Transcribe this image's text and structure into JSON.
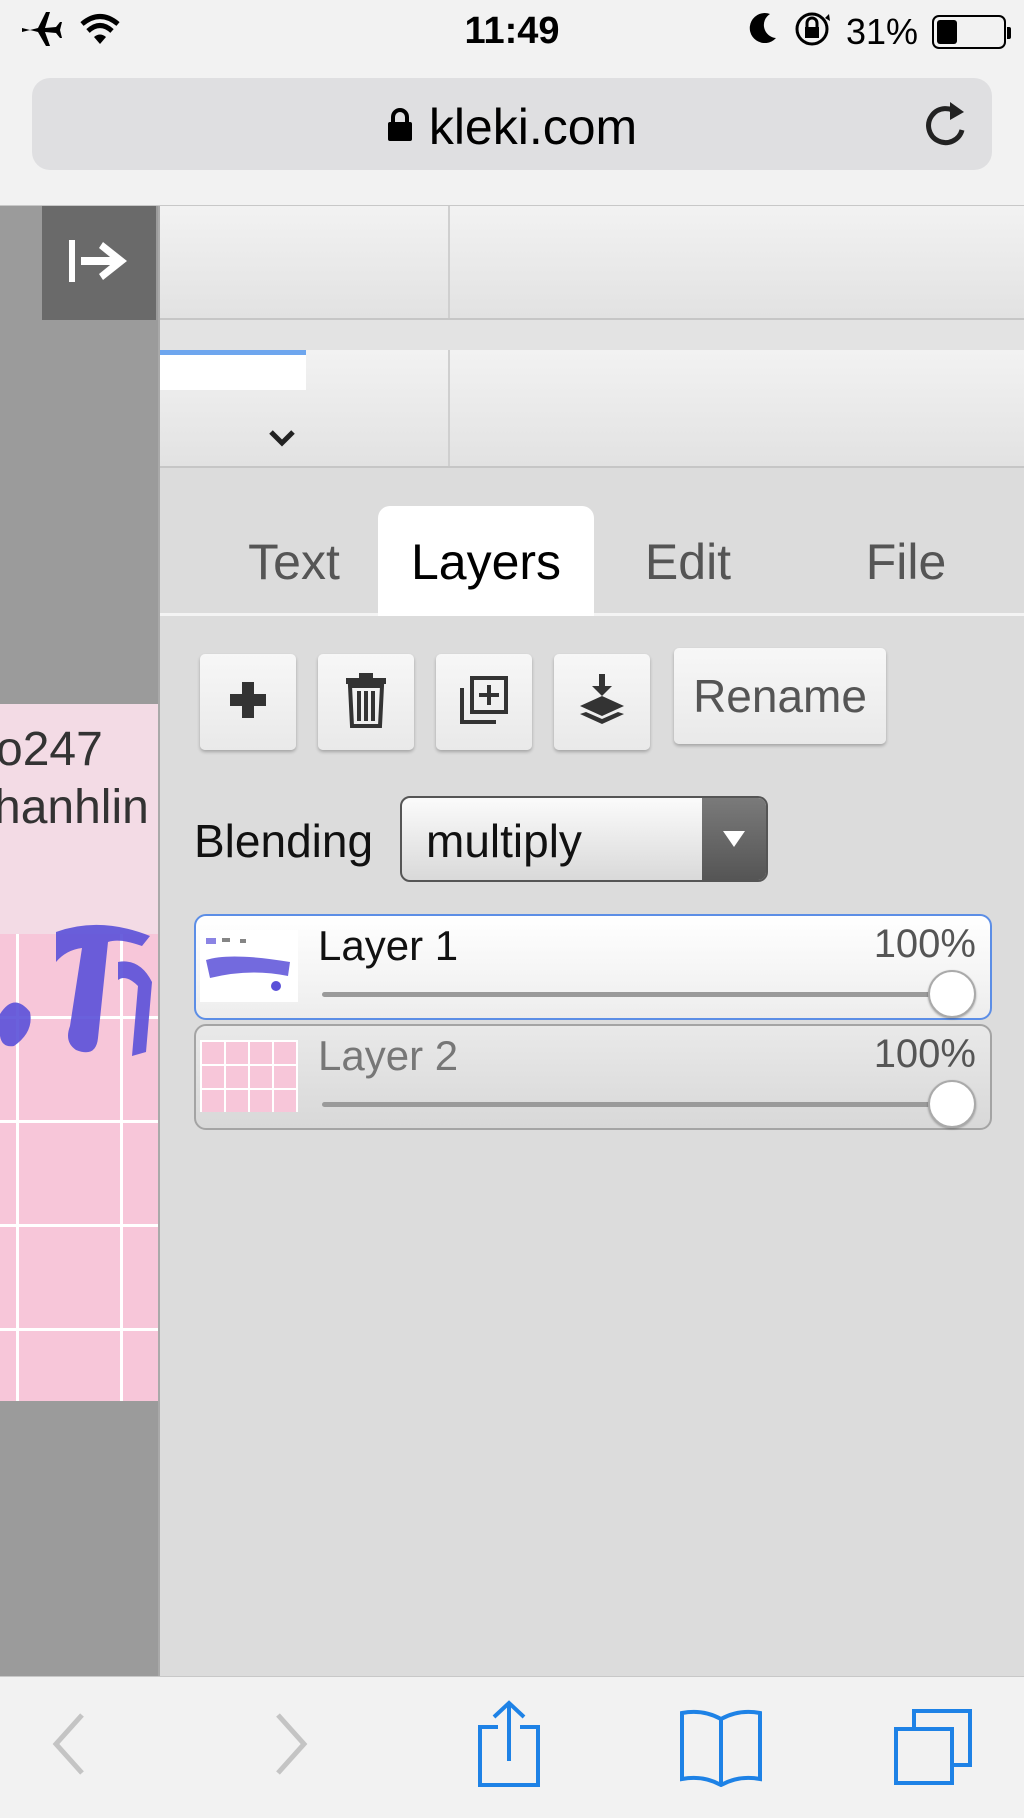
{
  "status_bar": {
    "time": "11:49",
    "battery_text": "31%",
    "battery_level": 0.31,
    "icons": [
      "airplane-icon",
      "wifi-icon",
      "moon-icon",
      "rotation-lock-icon",
      "battery-icon"
    ]
  },
  "browser": {
    "url": "kleki.com",
    "icons": [
      "lock-icon",
      "reload-icon"
    ]
  },
  "canvas": {
    "text_line1": "o247",
    "text_line2": "hanhlin"
  },
  "tabs": [
    {
      "label": "Text",
      "active": false
    },
    {
      "label": "Layers",
      "active": true
    },
    {
      "label": "Edit",
      "active": false
    },
    {
      "label": "File",
      "active": false
    }
  ],
  "layer_tools": {
    "icons": [
      "add-layer-icon",
      "delete-layer-icon",
      "duplicate-layer-icon",
      "merge-down-icon"
    ],
    "rename_label": "Rename"
  },
  "blending": {
    "label": "Blending",
    "value": "multiply"
  },
  "layers": [
    {
      "name": "Layer 1",
      "opacity_text": "100%",
      "opacity": 1.0,
      "selected": true
    },
    {
      "name": "Layer 2",
      "opacity_text": "100%",
      "opacity": 1.0,
      "selected": false
    }
  ],
  "colors": {
    "accent": "#5c8ee6",
    "ios_blue": "#1e82e6",
    "canvas_pink": "#f7c6d9",
    "ink_blue": "#5a50d8"
  },
  "bottom_bar": {
    "icons": [
      "back-icon",
      "forward-icon",
      "share-icon",
      "bookmarks-icon",
      "tabs-icon"
    ]
  }
}
